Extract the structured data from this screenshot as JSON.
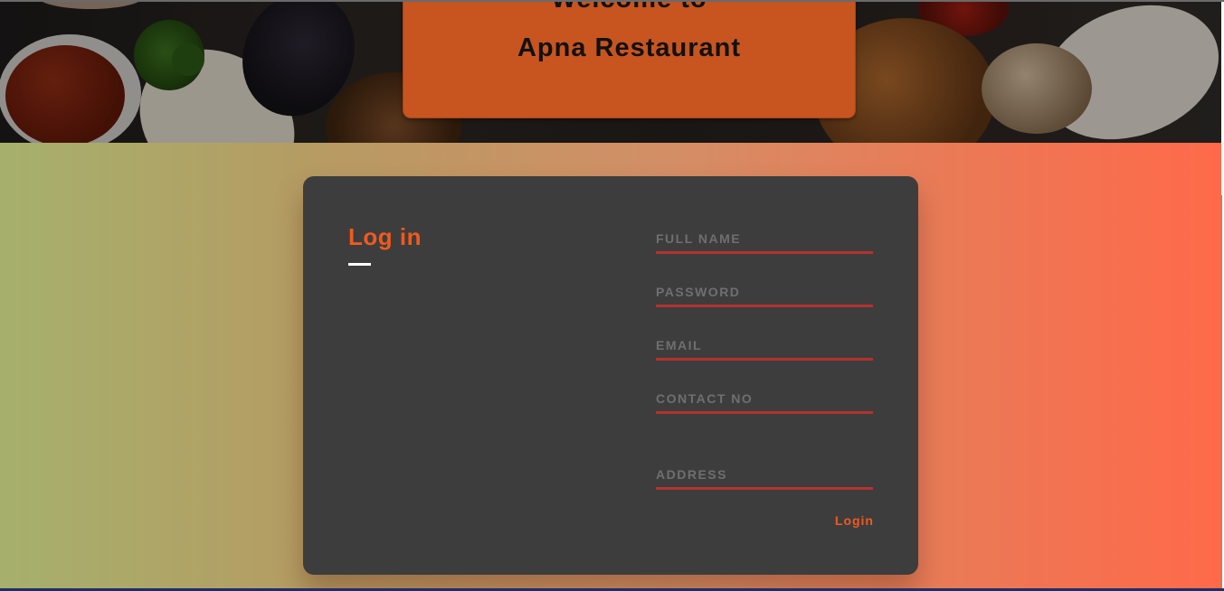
{
  "header": {
    "welcome_line1": "Welcome to",
    "welcome_line2": "Apna Restaurant"
  },
  "login_card": {
    "title": "Log in",
    "fields": {
      "full_name": {
        "placeholder": "FULL NAME",
        "value": ""
      },
      "password": {
        "placeholder": "PASSWORD",
        "value": ""
      },
      "email": {
        "placeholder": "EMAIL",
        "value": ""
      },
      "contact_no": {
        "placeholder": "CONTACT NO",
        "value": ""
      },
      "address": {
        "placeholder": "ADDRESS",
        "value": ""
      }
    },
    "submit_label": "Login"
  },
  "colors": {
    "accent": "#f05a1e",
    "banner": "#c85420",
    "card": "#3d3d3d",
    "field_underline": "#b3322f"
  }
}
